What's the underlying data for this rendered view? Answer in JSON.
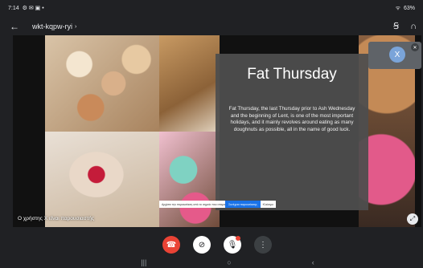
{
  "statusbar": {
    "time": "7:14",
    "left_icons": "⚙ ✉ ▣ •",
    "right_icons": "ᯤ",
    "battery": "63%"
  },
  "header": {
    "back_icon": "←",
    "meeting_code": "wkt-kqpw-ryi",
    "chevron": "›",
    "switch_audio_icon": "Ꞩ",
    "headset_icon": "∩"
  },
  "slide": {
    "title": "Fat Thursday",
    "body": "Fat Thursday, the last Thursday prior to Ash Wednesday and the beginning of Lent, is one of the most important holidays, and it mainly revolves around eating as many doughnuts as possible, all in the name of good luck."
  },
  "caption_bar": {
    "text": "Αρχίστε την παρουσίαση από το σημείο που σταματήσατε",
    "button": "Συνέχεια παρουσίασης",
    "close": "Κλείσιμο"
  },
  "participant_label": "Ο χρήστης Χ είναι παρουσιαστής",
  "self_tile": {
    "avatar_letter": "X",
    "mic_icon": "✕"
  },
  "fullscreen_icon": "⤢",
  "controls": {
    "hangup_icon": "☎",
    "camera_icon": "⊘",
    "mic_icon": "🎙",
    "more_icon": "⋮"
  },
  "navbar": {
    "recents": "|||",
    "home": "○",
    "back": "‹"
  },
  "colors": {
    "background": "#202124",
    "hangup": "#ea4335",
    "accent": "#1a73e8"
  }
}
